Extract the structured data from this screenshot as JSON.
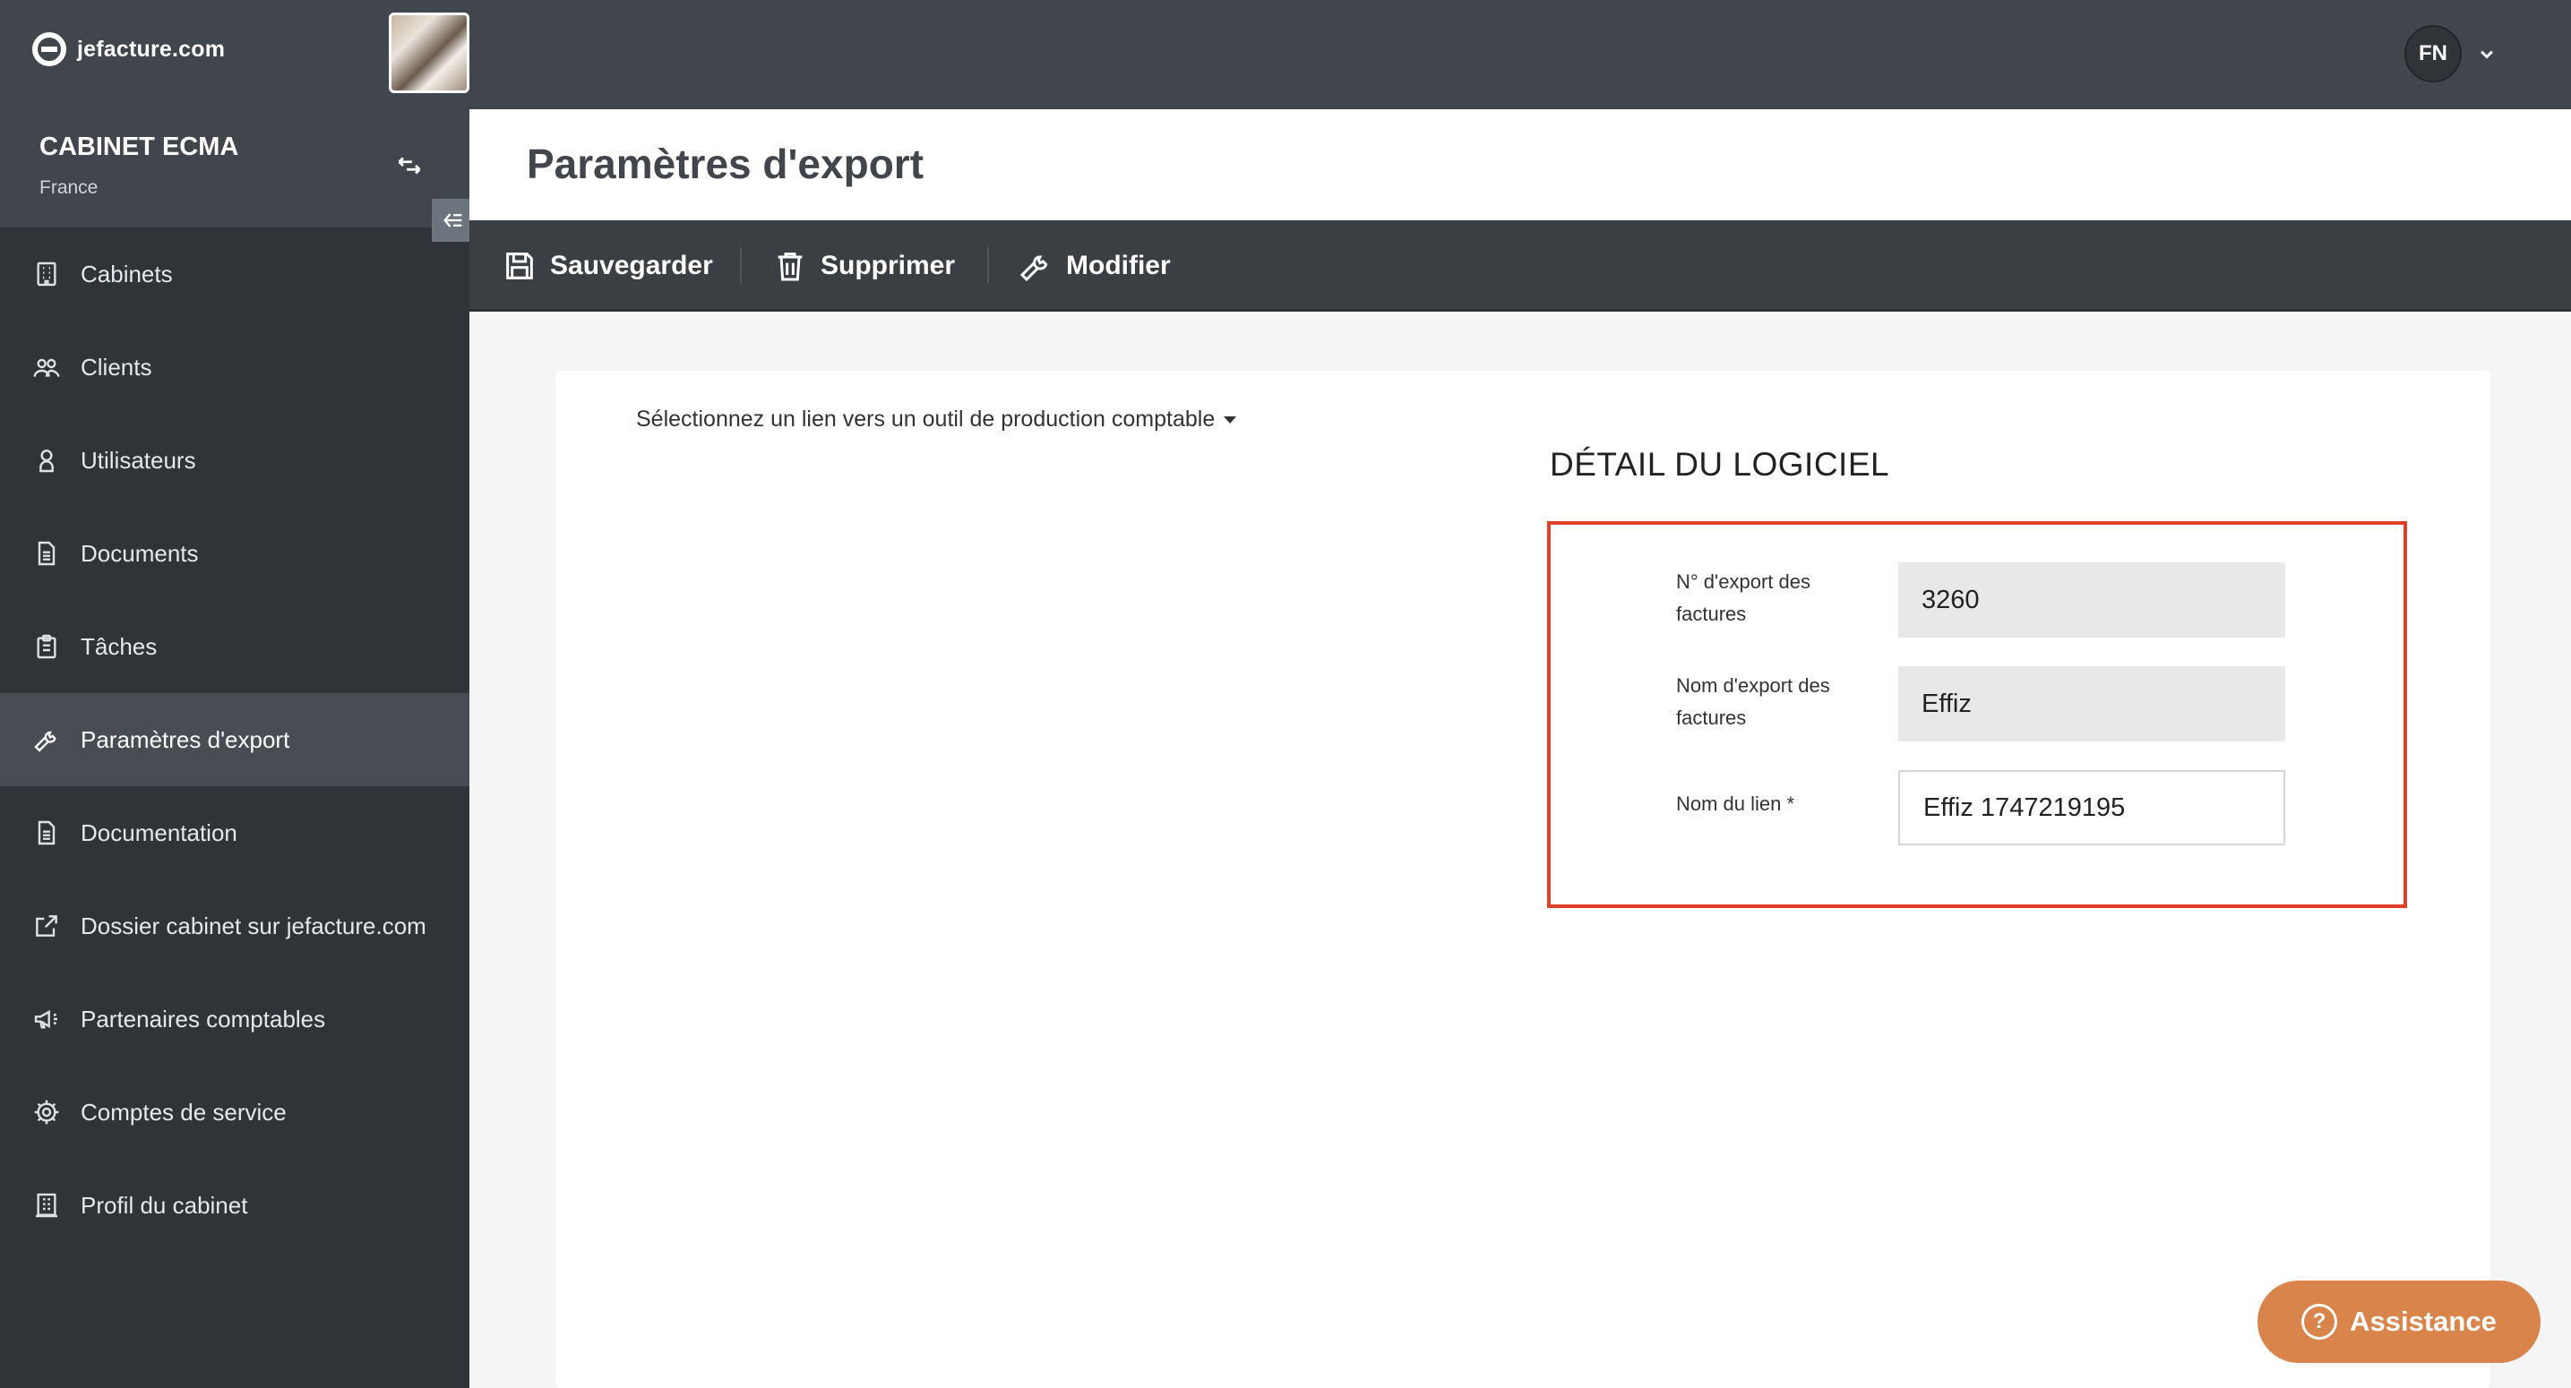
{
  "header": {
    "brand": "jefacture.com",
    "user_initials": "FN"
  },
  "org": {
    "name": "CABINET ECMA",
    "country": "France"
  },
  "sidebar": {
    "items": [
      {
        "label": "Cabinets",
        "icon": "building-icon"
      },
      {
        "label": "Clients",
        "icon": "users-icon"
      },
      {
        "label": "Utilisateurs",
        "icon": "user-icon"
      },
      {
        "label": "Documents",
        "icon": "document-icon"
      },
      {
        "label": "Tâches",
        "icon": "clipboard-icon"
      },
      {
        "label": "Paramètres d'export",
        "icon": "wrench-icon",
        "active": true
      },
      {
        "label": "Documentation",
        "icon": "document-icon"
      },
      {
        "label": "Dossier cabinet sur jefacture.com",
        "icon": "external-link-icon"
      },
      {
        "label": "Partenaires comptables",
        "icon": "megaphone-icon"
      },
      {
        "label": "Comptes de service",
        "icon": "gear-icon"
      },
      {
        "label": "Profil du cabinet",
        "icon": "office-building-icon"
      }
    ]
  },
  "page": {
    "title": "Paramètres d'export"
  },
  "toolbar": {
    "save_label": "Sauvegarder",
    "delete_label": "Supprimer",
    "edit_label": "Modifier"
  },
  "content": {
    "link_selector": "Sélectionnez un lien vers un outil de production comptable",
    "section_title": "DÉTAIL DU LOGICIEL",
    "fields": [
      {
        "label": "N° d'export des factures",
        "value": "3260",
        "readonly": true
      },
      {
        "label": "Nom d'export des factures",
        "value": "Effiz",
        "readonly": true
      },
      {
        "label": "Nom du lien *",
        "value": "Effiz 1747219195",
        "readonly": false
      }
    ]
  },
  "assistance": {
    "label": "Assistance"
  },
  "colors": {
    "header_bg": "#40464c",
    "sidebar_bg": "#2f3438",
    "highlight_border": "#e0402a",
    "assist_bg": "#d9844a"
  }
}
